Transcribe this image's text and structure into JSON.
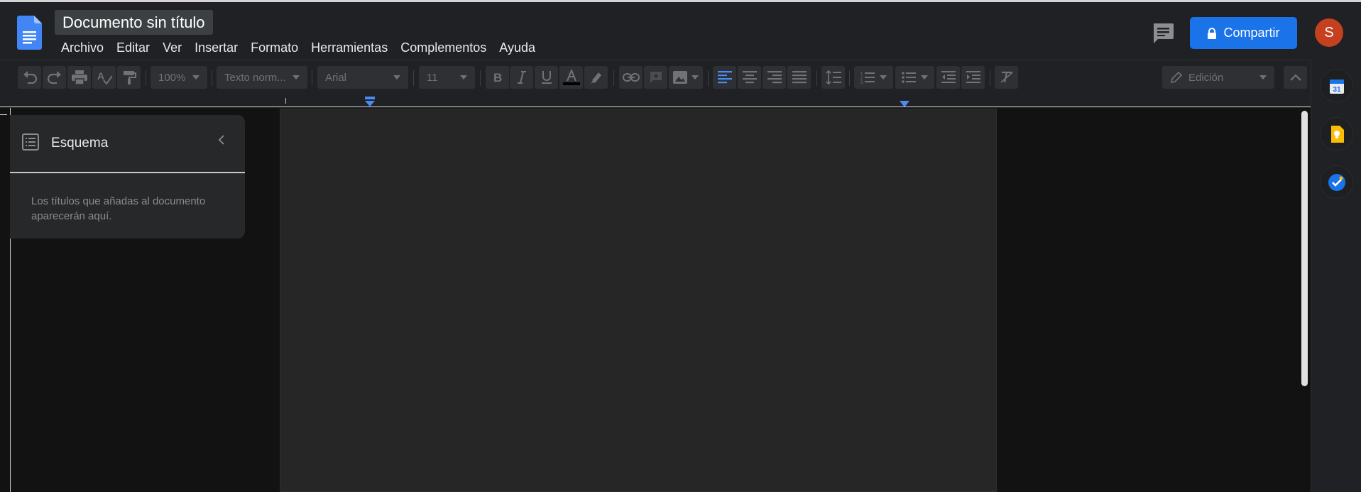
{
  "document": {
    "title": "Documento sin título"
  },
  "menu": [
    "Archivo",
    "Editar",
    "Ver",
    "Insertar",
    "Formato",
    "Herramientas",
    "Complementos",
    "Ayuda"
  ],
  "header": {
    "share_label": "Compartir",
    "avatar_initial": "S"
  },
  "toolbar": {
    "zoom": "100%",
    "style": "Texto norm...",
    "font": "Arial",
    "font_size": "11",
    "mode": "Edición",
    "text_color": "#000000"
  },
  "outline": {
    "title": "Esquema",
    "hint": "Los títulos que añadas al documento aparecerán aquí."
  },
  "side_apps": {
    "calendar_day": "31"
  },
  "colors": {
    "accent": "#1a73e8",
    "avatar": "#c5401f",
    "background": "#121212",
    "bar": "#202124"
  }
}
